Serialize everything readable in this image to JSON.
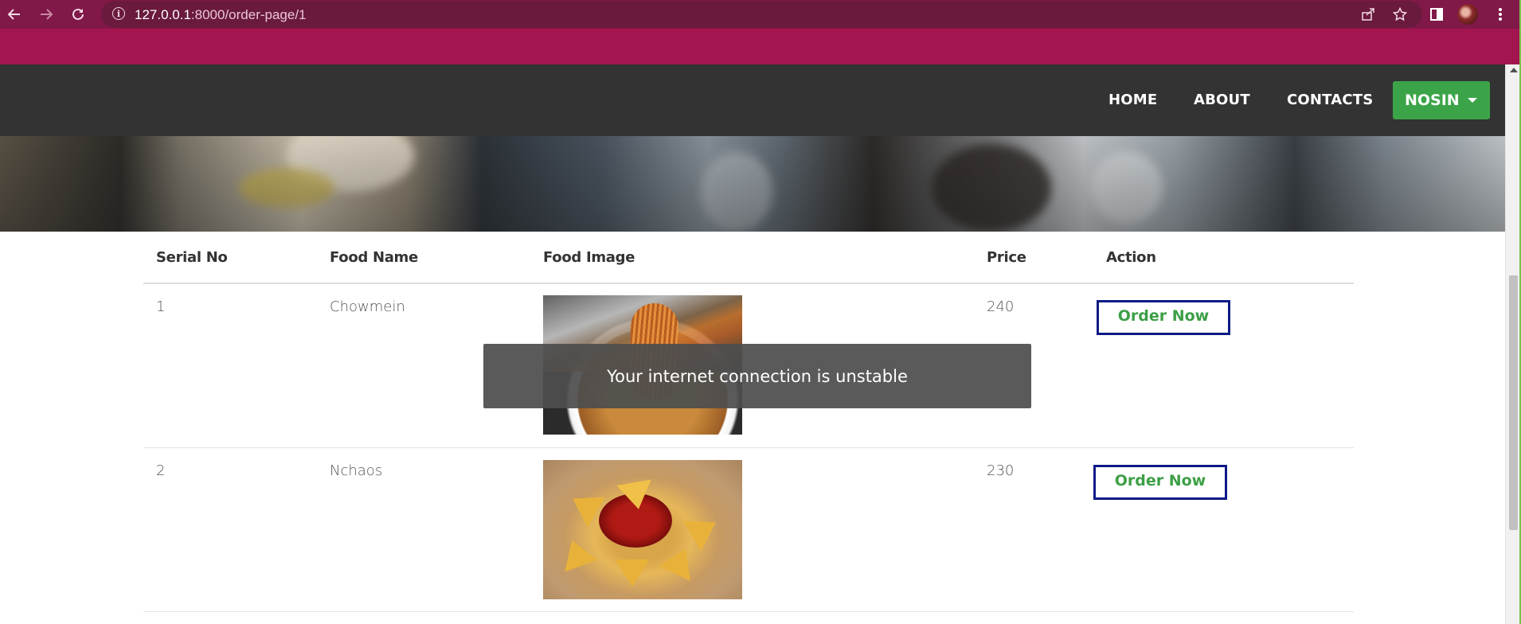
{
  "browser": {
    "url_host": "127.0.0.1",
    "url_path": ":8000/order-page/1",
    "back_icon": "arrow-left-icon",
    "forward_icon": "arrow-right-icon",
    "reload_icon": "reload-icon",
    "share_icon": "share-icon",
    "bookmark_icon": "star-icon",
    "sidepanel_icon": "side-panel-icon",
    "menu_icon": "kebab-menu-icon",
    "chrome_color": "#801848",
    "theme_color": "#a2154f"
  },
  "navbar": {
    "items": [
      {
        "label": "HOME"
      },
      {
        "label": "ABOUT"
      },
      {
        "label": "CONTACTS"
      }
    ],
    "user_label": "NOSIN",
    "background": "#333333",
    "accent": "#3ca448"
  },
  "table": {
    "headers": {
      "serial": "Serial No",
      "name": "Food Name",
      "image": "Food Image",
      "price": "Price",
      "action": "Action"
    },
    "rows": [
      {
        "serial": "1",
        "name": "Chowmein",
        "price": "240",
        "action": "Order Now"
      },
      {
        "serial": "2",
        "name": "Nchaos",
        "price": "230",
        "action": "Order Now"
      }
    ],
    "button_border_color": "#0d1a86",
    "button_text_color": "#3c9f46"
  },
  "toast": {
    "message": "Your internet connection is unstable"
  }
}
